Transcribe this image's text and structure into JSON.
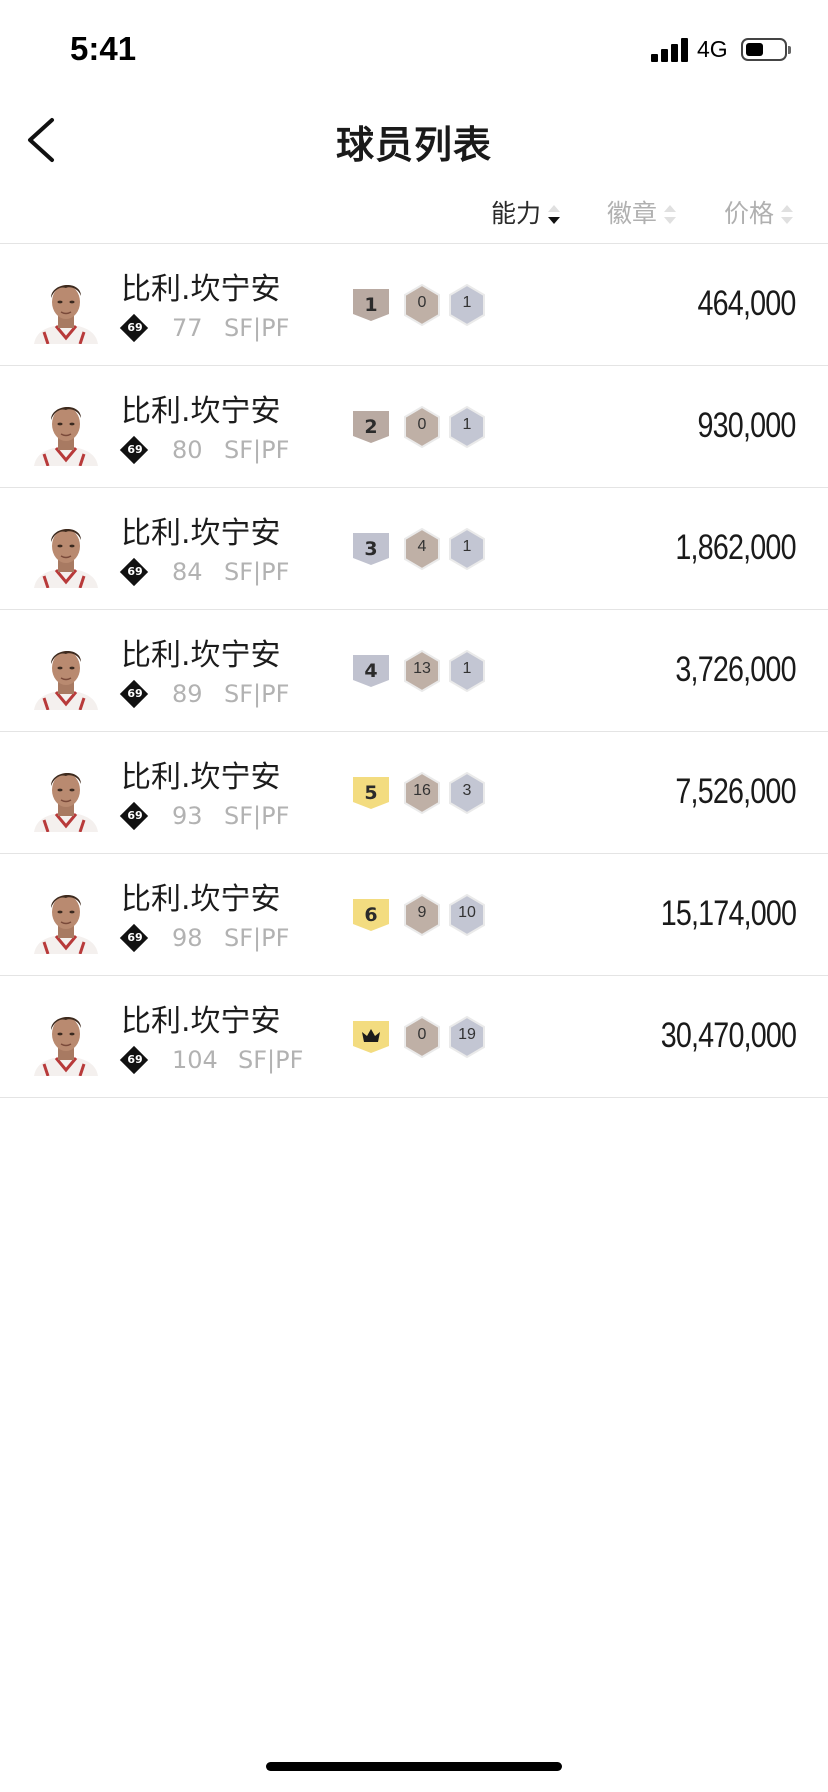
{
  "status_bar": {
    "time": "5:41",
    "network": "4G",
    "battery_level": 0.45
  },
  "header": {
    "title": "球员列表"
  },
  "sort_options": [
    {
      "label": "能力",
      "active": true
    },
    {
      "label": "徽章",
      "active": false
    },
    {
      "label": "价格",
      "active": false
    }
  ],
  "players": [
    {
      "name": "比利.坎宁安",
      "ovr_icon": "69",
      "rating": "77",
      "position": "SF|PF",
      "level": "1",
      "level_color": "#b9aaa2",
      "badge_a": "0",
      "badge_b": "1",
      "price": "464,000"
    },
    {
      "name": "比利.坎宁安",
      "ovr_icon": "69",
      "rating": "80",
      "position": "SF|PF",
      "level": "2",
      "level_color": "#b9aaa2",
      "badge_a": "0",
      "badge_b": "1",
      "price": "930,000"
    },
    {
      "name": "比利.坎宁安",
      "ovr_icon": "69",
      "rating": "84",
      "position": "SF|PF",
      "level": "3",
      "level_color": "#c0c2cf",
      "badge_a": "4",
      "badge_b": "1",
      "price": "1,862,000"
    },
    {
      "name": "比利.坎宁安",
      "ovr_icon": "69",
      "rating": "89",
      "position": "SF|PF",
      "level": "4",
      "level_color": "#c0c2cf",
      "badge_a": "13",
      "badge_b": "1",
      "price": "3,726,000"
    },
    {
      "name": "比利.坎宁安",
      "ovr_icon": "69",
      "rating": "93",
      "position": "SF|PF",
      "level": "5",
      "level_color": "#f3dc80",
      "badge_a": "16",
      "badge_b": "3",
      "price": "7,526,000"
    },
    {
      "name": "比利.坎宁安",
      "ovr_icon": "69",
      "rating": "98",
      "position": "SF|PF",
      "level": "6",
      "level_color": "#f3dc80",
      "badge_a": "9",
      "badge_b": "10",
      "price": "15,174,000"
    },
    {
      "name": "比利.坎宁安",
      "ovr_icon": "69",
      "rating": "104",
      "position": "SF|PF",
      "level": "crown-icon",
      "level_color": "#f3dc80",
      "badge_a": "0",
      "badge_b": "19",
      "price": "30,470,000"
    }
  ],
  "colors": {
    "hex_bronze": "#bfb0a6",
    "hex_silver": "#c3c6d3",
    "active_text": "#2a2a2a",
    "muted_text": "#b0b0b0"
  }
}
